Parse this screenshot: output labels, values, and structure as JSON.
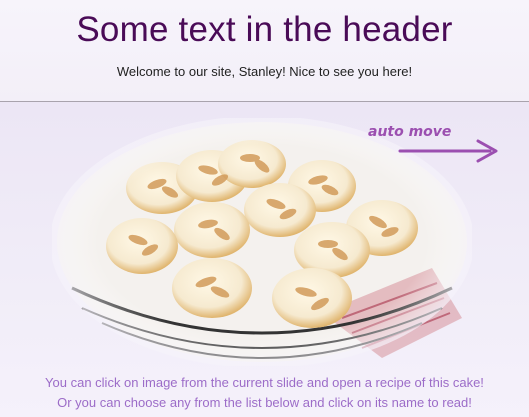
{
  "header": {
    "title": "Some text in the header",
    "welcome": "Welcome to our site, Stanley! Nice to see you here!"
  },
  "slider": {
    "auto_move_label": "auto move",
    "image_icon": "cake-photo",
    "accent_color": "#9b4fb0"
  },
  "captions": {
    "line1": "You can click on image from the current slide and open a recipe of this cake!",
    "line2": "Or you can choose any from the list below and click on its name to read!"
  }
}
